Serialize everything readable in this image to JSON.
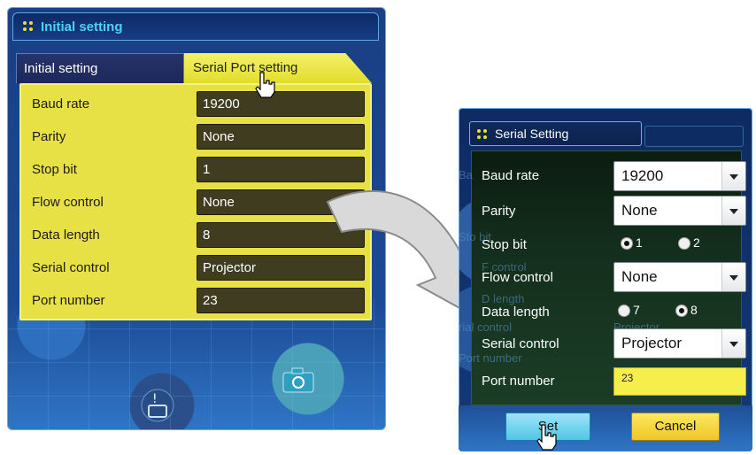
{
  "left": {
    "title": "Initial setting",
    "tabs": [
      "Initial setting",
      "Serial Port setting"
    ],
    "rows": [
      {
        "label": "Baud rate",
        "value": "19200"
      },
      {
        "label": "Parity",
        "value": "None"
      },
      {
        "label": "Stop bit",
        "value": "1"
      },
      {
        "label": "Flow control",
        "value": "None"
      },
      {
        "label": "Data length",
        "value": "8"
      },
      {
        "label": "Serial control",
        "value": "Projector"
      },
      {
        "label": "Port number",
        "value": "23"
      }
    ]
  },
  "right": {
    "title": "Serial Setting",
    "baud_label": "Baud rate",
    "baud_value": "19200",
    "parity_label": "Parity",
    "parity_value": "None",
    "stopbit_label": "Stop bit",
    "stopbit_options": [
      "1",
      "2"
    ],
    "stopbit_selected": "1",
    "flow_label": "Flow control",
    "flow_value": "None",
    "datalength_label": "Data length",
    "datalength_options": [
      "7",
      "8"
    ],
    "datalength_selected": "8",
    "serialcontrol_label": "Serial control",
    "serialcontrol_value": "Projector",
    "port_label": "Port number",
    "port_value": "23",
    "set_label": "Set",
    "cancel_label": "Cancel",
    "ghost": {
      "baud": "Ba",
      "stop": "Sto bit",
      "flow": "F control",
      "data": "D length",
      "serial": "rial control",
      "serial_value": "Projector",
      "port": "Port number"
    }
  },
  "colors": {
    "accent_yellow": "#e8e146",
    "panel_blue": "#1b4a94",
    "title_cyan": "#4ad4f4"
  }
}
